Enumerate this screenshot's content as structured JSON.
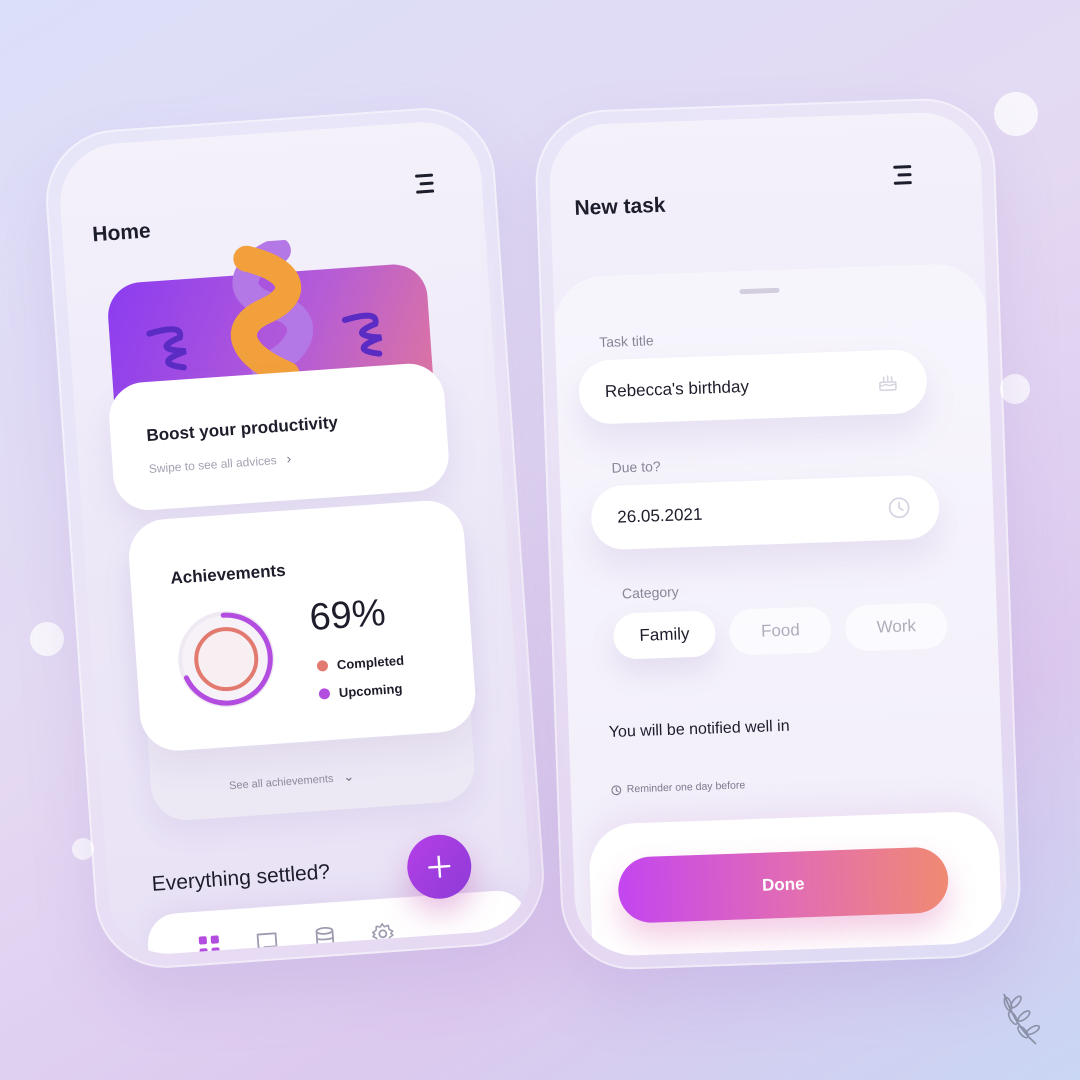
{
  "home": {
    "title": "Home",
    "hero": {
      "title": "Boost your productivity",
      "subtitle": "Swipe to see all advices"
    },
    "achievements": {
      "title": "Achievements",
      "percent": "69%",
      "completed_fraction": 0.69,
      "legend": [
        {
          "label": "Completed",
          "color": "#e27a6f"
        },
        {
          "label": "Upcoming",
          "color": "#b34de0"
        }
      ],
      "see_all": "See all achievements"
    },
    "prompt": "Everything settled?",
    "nav": [
      "grid-icon",
      "chat-icon",
      "database-icon",
      "settings-icon"
    ],
    "fab_icon": "plus-icon"
  },
  "new_task": {
    "title": "New task",
    "task_title_label": "Task title",
    "task_title_value": "Rebecca's birthday",
    "due_label": "Due to?",
    "due_value": "26.05.2021",
    "category_label": "Category",
    "categories": [
      {
        "label": "Family",
        "selected": true
      },
      {
        "label": "Food",
        "selected": false
      },
      {
        "label": "Work",
        "selected": false
      }
    ],
    "notify_text": "You will be notified well in",
    "reminder_text": "Reminder one day before",
    "done_label": "Done"
  },
  "colors": {
    "accent_purple": "#b34de0",
    "accent_coral": "#f08a72",
    "text_dark": "#1d1d2b"
  }
}
